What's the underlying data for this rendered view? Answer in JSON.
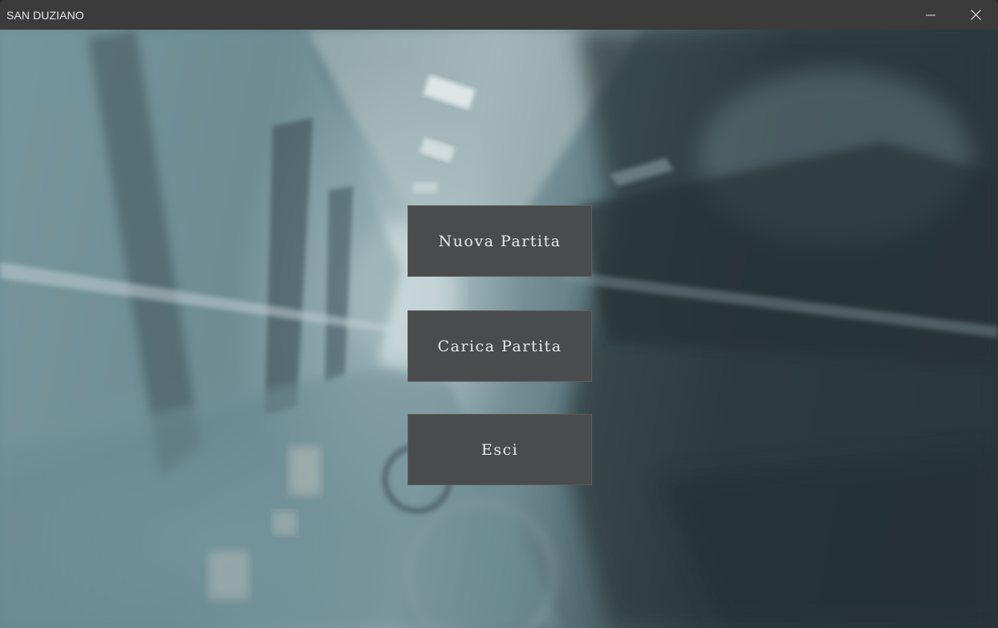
{
  "window": {
    "title": "SAN DUZIANO",
    "minimize_icon": "minimize-icon",
    "close_icon": "close-icon"
  },
  "background": {
    "description_icon": "hospital-corridor-background"
  },
  "menu": {
    "new_game_label": "Nuova Partita",
    "load_game_label": "Carica Partita",
    "exit_label": "Esci"
  },
  "colors": {
    "titlebar": "#3b3b3b",
    "button": "#4a4b4d",
    "button_text": "#e9e9e9"
  }
}
